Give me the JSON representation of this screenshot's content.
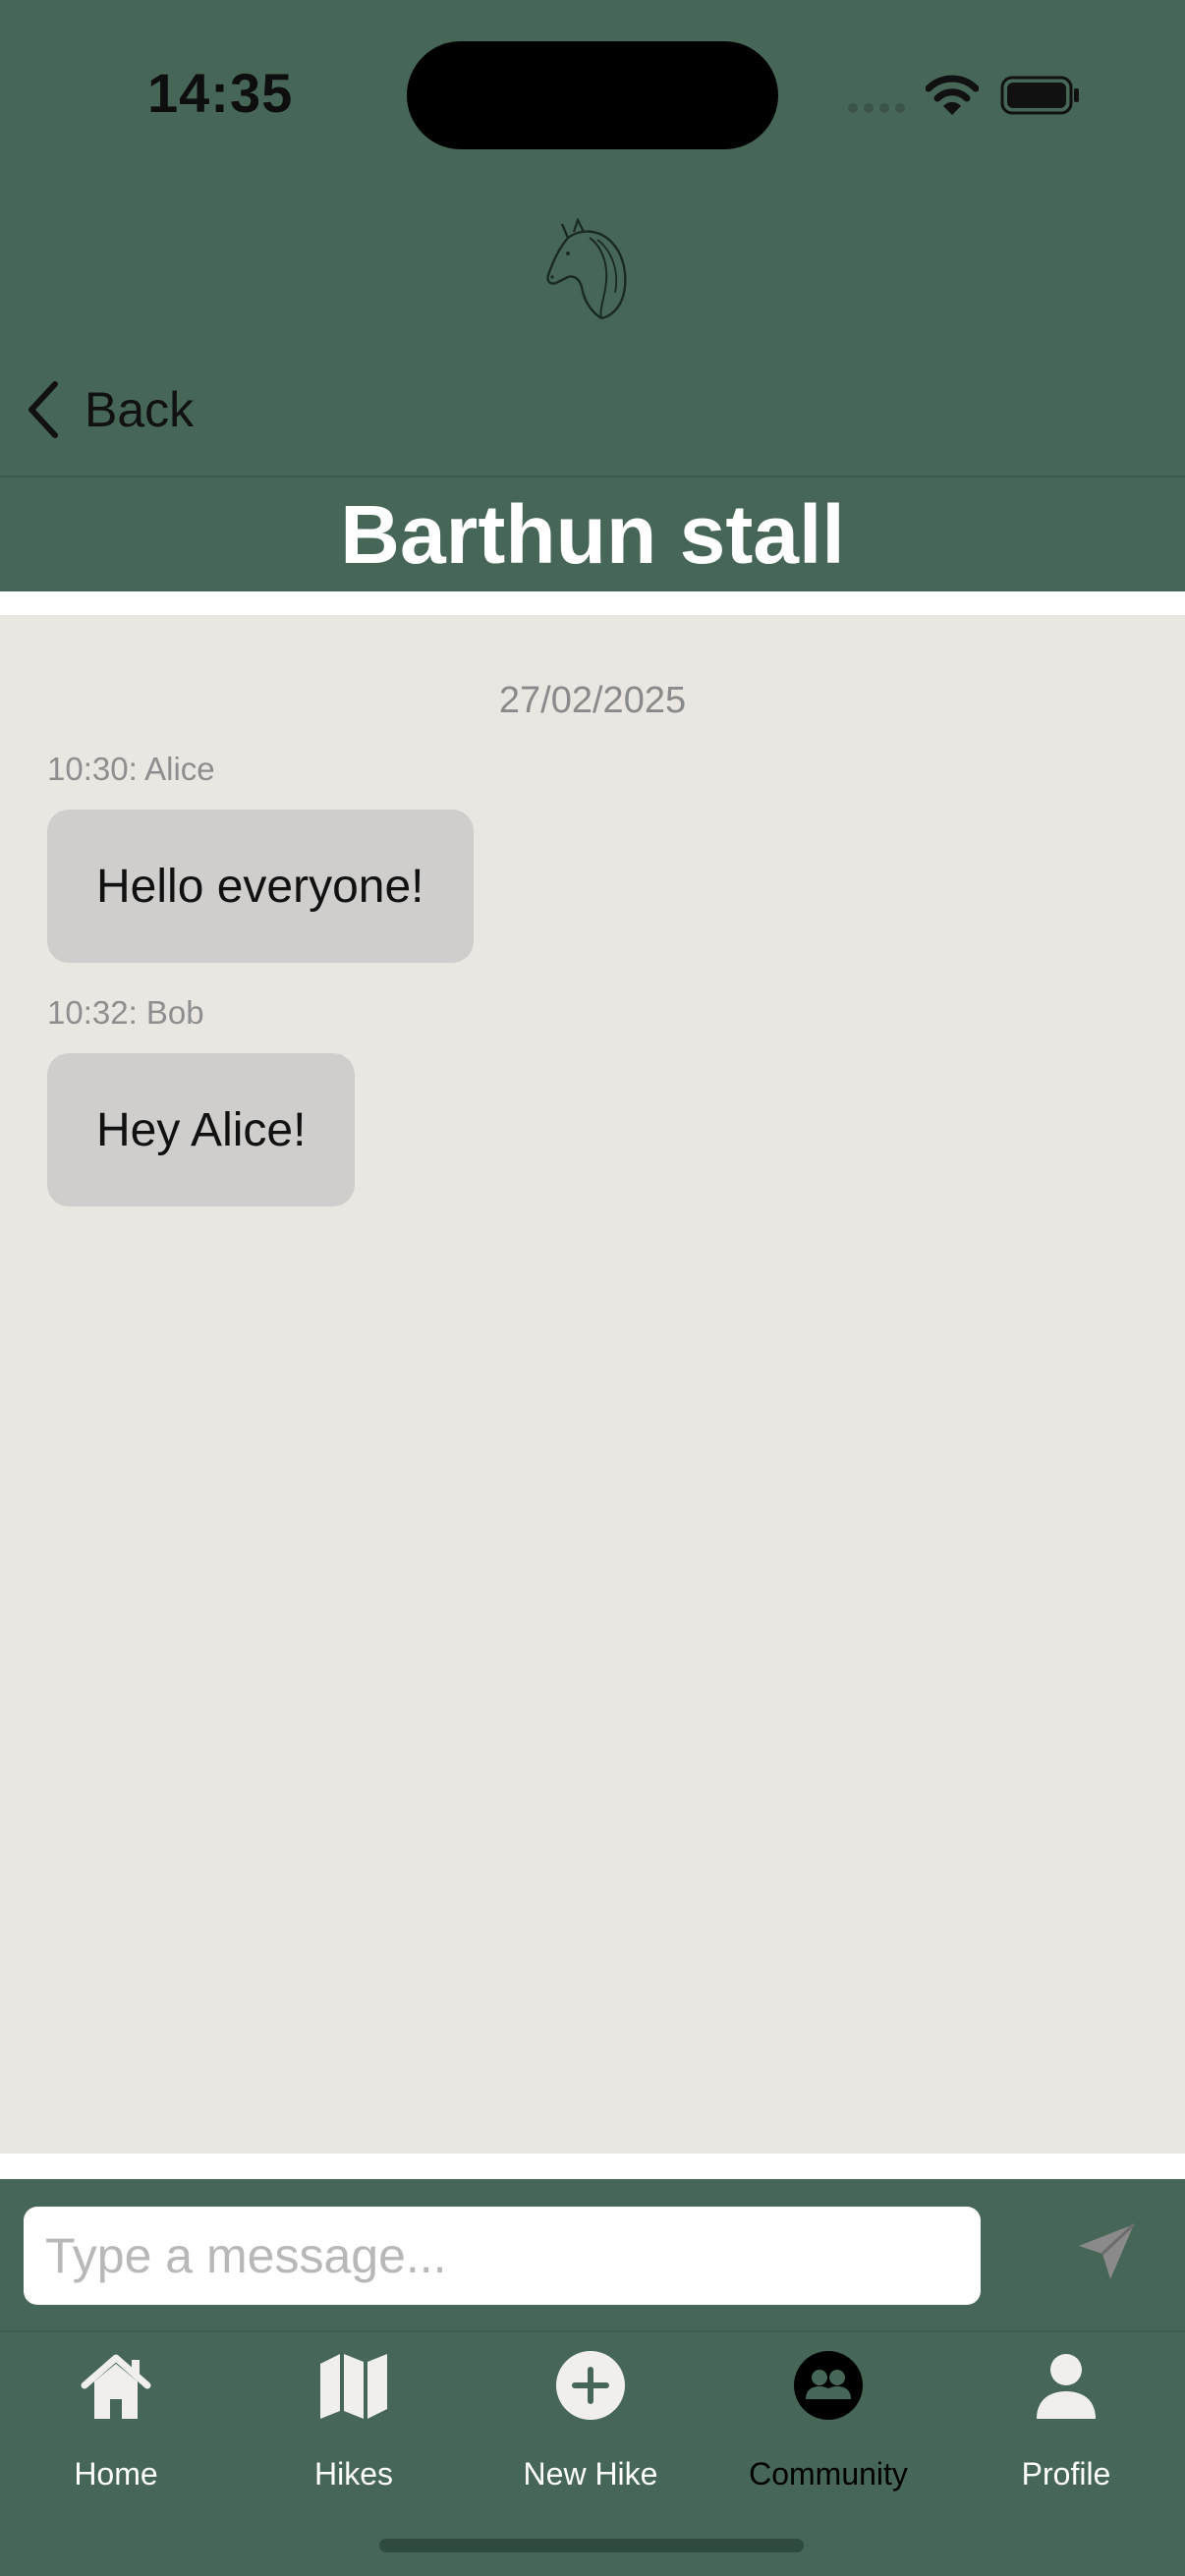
{
  "status_bar": {
    "time": "14:35"
  },
  "header": {
    "logo": "horse-head-icon",
    "back_label": "Back",
    "title": "Barthun stall"
  },
  "chat": {
    "date": "27/02/2025",
    "messages": [
      {
        "meta": "10:30: Alice",
        "text": "Hello everyone!"
      },
      {
        "meta": "10:32: Bob",
        "text": "Hey Alice!"
      }
    ]
  },
  "compose": {
    "placeholder": "Type a message...",
    "send_icon": "paper-plane-icon"
  },
  "tab_bar": {
    "items": [
      {
        "label": "Home",
        "icon": "house-icon",
        "active": false
      },
      {
        "label": "Hikes",
        "icon": "map-icon",
        "active": false
      },
      {
        "label": "New Hike",
        "icon": "plus-circle-icon",
        "active": false
      },
      {
        "label": "Community",
        "icon": "people-circle-icon",
        "active": true
      },
      {
        "label": "Profile",
        "icon": "person-icon",
        "active": false
      }
    ]
  },
  "colors": {
    "brand_green": "#466758",
    "chat_background": "#eae6e2",
    "bubble": "#d0cecc",
    "tab_inactive": "#ffffff",
    "tab_active": "#000000"
  }
}
